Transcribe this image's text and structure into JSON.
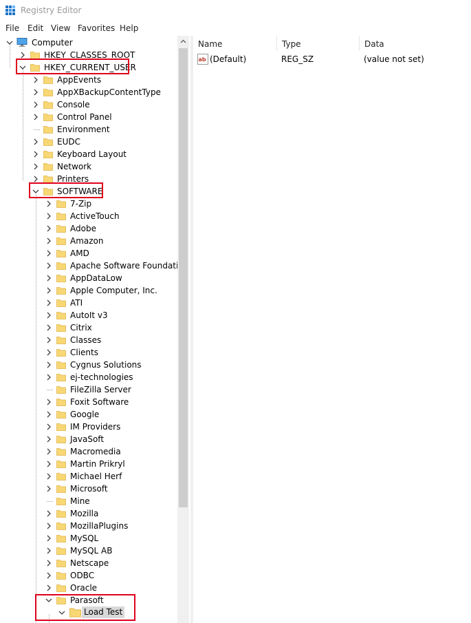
{
  "window": {
    "title": "Registry Editor"
  },
  "menu": {
    "file": "File",
    "edit": "Edit",
    "view": "View",
    "favorites": "Favorites",
    "help": "Help"
  },
  "tree": {
    "root": "Computer",
    "hives": {
      "classes_root": "HKEY_CLASSES_ROOT",
      "current_user": "HKEY_CURRENT_USER"
    },
    "hkcu_children": [
      "AppEvents",
      "AppXBackupContentType",
      "Console",
      "Control Panel",
      "Environment",
      "EUDC",
      "Keyboard Layout",
      "Network",
      "Printers",
      "SOFTWARE"
    ],
    "software_children": [
      "7-Zip",
      "ActiveTouch",
      "Adobe",
      "Amazon",
      "AMD",
      "Apache Software Foundation",
      "AppDataLow",
      "Apple Computer, Inc.",
      "ATI",
      "AutoIt v3",
      "Citrix",
      "Classes",
      "Clients",
      "Cygnus Solutions",
      "ej-technologies",
      "FileZilla Server",
      "Foxit Software",
      "Google",
      "IM Providers",
      "JavaSoft",
      "Macromedia",
      "Martin Prikryl",
      "Michael Herf",
      "Microsoft",
      "Mine",
      "Mozilla",
      "MozillaPlugins",
      "MySQL",
      "MySQL AB",
      "Netscape",
      "ODBC",
      "Oracle",
      "Parasoft"
    ],
    "parasoft_children": [
      "Load Test"
    ],
    "selected": "Load Test"
  },
  "list": {
    "columns": {
      "name": "Name",
      "type": "Type",
      "data": "Data"
    },
    "rows": [
      {
        "name": "(Default)",
        "type": "REG_SZ",
        "data": "(value not set)",
        "icon": "string-value-icon"
      }
    ]
  },
  "colors": {
    "highlight_box": "#e0001b",
    "folder": "#f8d775",
    "selection": "#d9d9d9"
  }
}
